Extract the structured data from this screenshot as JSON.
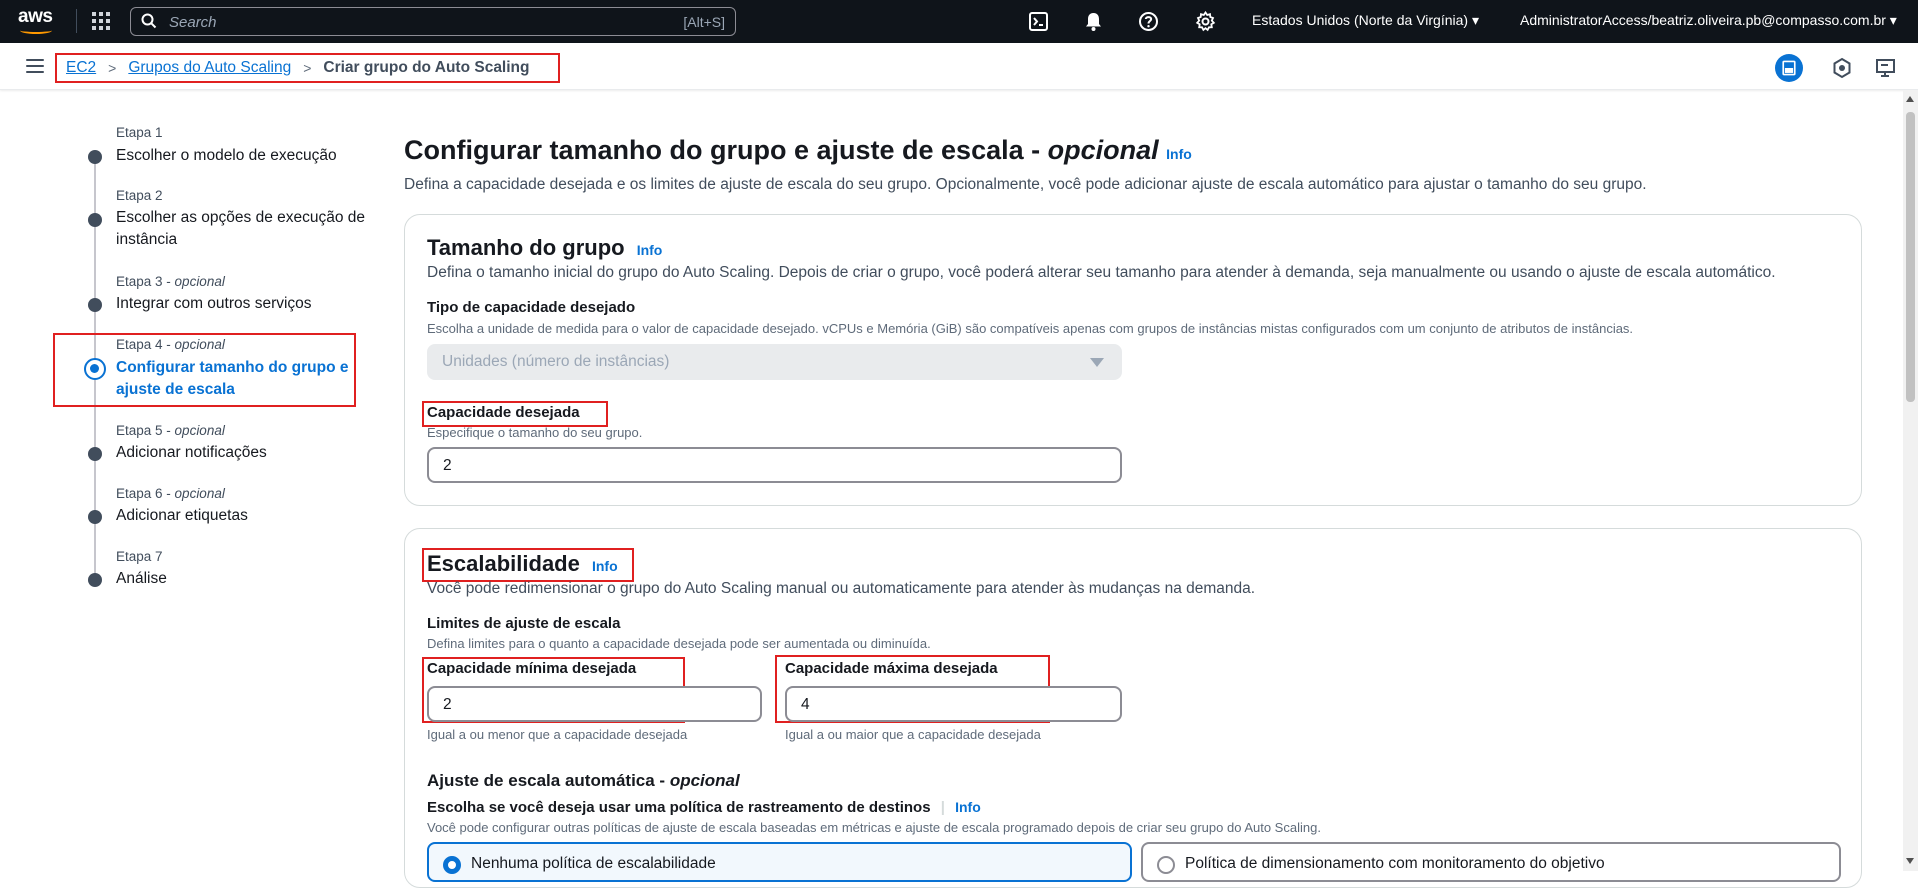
{
  "topnav": {
    "logo_text": "aws",
    "search_placeholder": "Search",
    "search_shortcut": "[Alt+S]",
    "region": "Estados Unidos (Norte da Virgínia) ▾",
    "account": "AdministratorAccess/beatriz.oliveira.pb@compasso.com.br ▾",
    "icons": [
      "cloudshell-icon",
      "bell-icon",
      "help-icon",
      "gear-icon"
    ]
  },
  "breadcrumb": {
    "items": [
      "EC2",
      "Grupos do Auto Scaling"
    ],
    "current": "Criar grupo do Auto Scaling"
  },
  "wizard": {
    "steps": [
      {
        "label": "Etapa 1",
        "optional": "",
        "title": "Escolher o modelo de execução"
      },
      {
        "label": "Etapa 2",
        "optional": "",
        "title": "Escolher as opções de execução de instância"
      },
      {
        "label": "Etapa 3 - ",
        "optional": "opcional",
        "title": "Integrar com outros serviços"
      },
      {
        "label": "Etapa 4 - ",
        "optional": "opcional",
        "title": "Configurar tamanho do grupo e ajuste de escala"
      },
      {
        "label": "Etapa 5 - ",
        "optional": "opcional",
        "title": "Adicionar notificações"
      },
      {
        "label": "Etapa 6 - ",
        "optional": "opcional",
        "title": "Adicionar etiquetas"
      },
      {
        "label": "Etapa 7",
        "optional": "",
        "title": "Análise"
      }
    ],
    "active_index": 3
  },
  "main": {
    "title": "Configurar tamanho do grupo e ajuste de escala - ",
    "title_optional": "opcional",
    "info": "Info",
    "description": "Defina a capacidade desejada e os limites de ajuste de escala do seu grupo. Opcionalmente, você pode adicionar ajuste de escala automático para ajustar o tamanho do seu grupo."
  },
  "group_size": {
    "title": "Tamanho do grupo",
    "info": "Info",
    "description": "Defina o tamanho inicial do grupo do Auto Scaling. Depois de criar o grupo, você poderá alterar seu tamanho para atender à demanda, seja manualmente ou usando o ajuste de escala automático.",
    "capacity_type_label": "Tipo de capacidade desejado",
    "capacity_type_desc": "Escolha a unidade de medida para o valor de capacidade desejado. vCPUs e Memória (GiB) são compatíveis apenas com grupos de instâncias mistas configurados com um conjunto de atributos de instâncias.",
    "capacity_type_value": "Unidades (número de instâncias)",
    "desired_label": "Capacidade desejada",
    "desired_desc": "Especifique o tamanho do seu grupo.",
    "desired_value": "2"
  },
  "scaling": {
    "title": "Escalabilidade",
    "info": "Info",
    "description": "Você pode redimensionar o grupo do Auto Scaling manual ou automaticamente para atender às mudanças na demanda.",
    "limits_label": "Limites de ajuste de escala",
    "limits_desc": "Defina limites para o quanto a capacidade desejada pode ser aumentada ou diminuída.",
    "min_label": "Capacidade mínima desejada",
    "min_value": "2",
    "min_hint": "Igual a ou menor que a capacidade desejada",
    "max_label": "Capacidade máxima desejada",
    "max_value": "4",
    "max_hint": "Igual a ou maior que a capacidade desejada",
    "auto_title": "Ajuste de escala automática - ",
    "auto_optional": "opcional",
    "policy_label": "Escolha se você deseja usar uma política de rastreamento de destinos",
    "policy_info": "Info",
    "policy_desc": "Você pode configurar outras políticas de ajuste de escala baseadas em métricas e ajuste de escala programado depois de criar seu grupo do Auto Scaling.",
    "option_none": "Nenhuma política de escalabilidade",
    "option_target": "Política de dimensionamento com monitoramento do objetivo"
  }
}
